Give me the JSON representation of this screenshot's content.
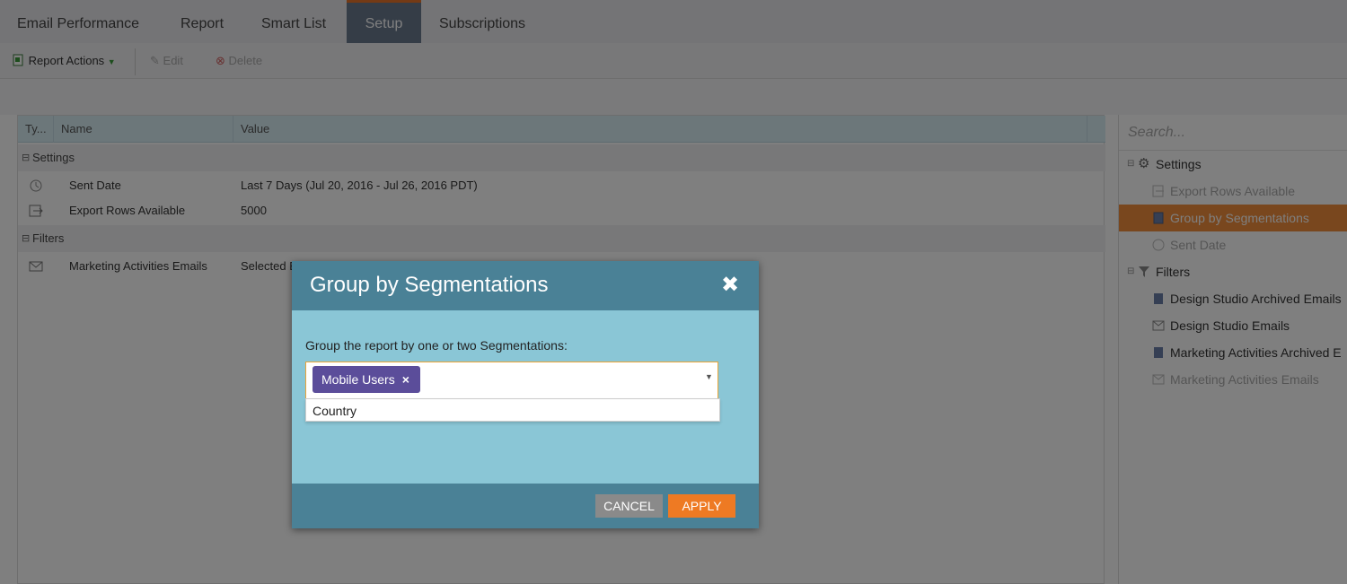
{
  "tabs": [
    {
      "label": "Email Performance"
    },
    {
      "label": "Report"
    },
    {
      "label": "Smart List"
    },
    {
      "label": "Setup"
    },
    {
      "label": "Subscriptions"
    }
  ],
  "active_tab": "Setup",
  "toolbar": {
    "report_actions": "Report Actions",
    "edit": "Edit",
    "delete": "Delete"
  },
  "grid": {
    "columns": [
      "Ty...",
      "Name",
      "Value"
    ],
    "groups": {
      "settings": "Settings",
      "filters": "Filters"
    },
    "rows": [
      {
        "icon": "clock-icon",
        "name": "Sent Date",
        "value": "Last 7 Days (Jul 20, 2016 - Jul 26, 2016 PDT)"
      },
      {
        "icon": "export-icon",
        "name": "Export Rows Available",
        "value": "5000"
      },
      {
        "icon": "email-icon",
        "name": "Marketing Activities Emails",
        "value": "Selected E"
      }
    ]
  },
  "right_panel": {
    "search_placeholder": "Search...",
    "settings_label": "Settings",
    "settings_items": [
      {
        "label": "Export Rows Available",
        "state": "disabled"
      },
      {
        "label": "Group by Segmentations",
        "state": "selected"
      },
      {
        "label": "Sent Date",
        "state": "disabled"
      }
    ],
    "filters_label": "Filters",
    "filter_items": [
      {
        "label": "Design Studio Archived Emails",
        "state": "normal"
      },
      {
        "label": "Design Studio Emails",
        "state": "normal"
      },
      {
        "label": "Marketing Activities Archived E",
        "state": "normal"
      },
      {
        "label": "Marketing Activities Emails",
        "state": "disabled"
      }
    ]
  },
  "dialog": {
    "title": "Group by Segmentations",
    "label": "Group the report by one or two Segmentations:",
    "selected_chip": "Mobile Users",
    "dropdown_options": [
      "Country"
    ],
    "cancel": "CANCEL",
    "apply": "APPLY"
  },
  "colors": {
    "accent": "#ee7a23",
    "dialog_header": "#4a8196",
    "dialog_body": "#8ac6d6",
    "chip": "#5b4d9a",
    "selected_node": "#f28e3c"
  }
}
